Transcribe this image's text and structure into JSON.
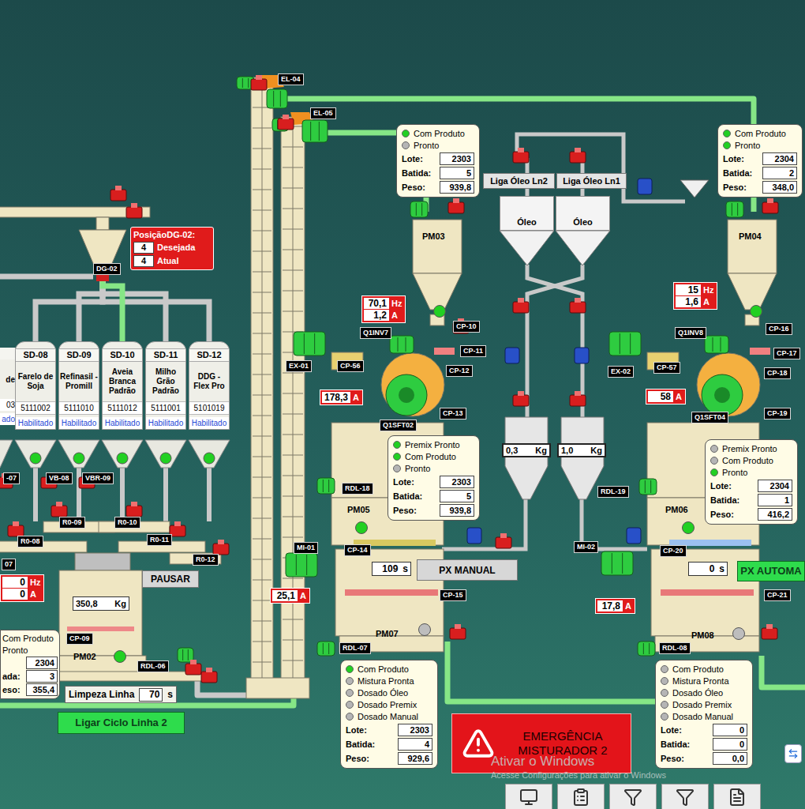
{
  "bins": [
    {
      "tag": "SD-08",
      "product": "Farelo de Soja",
      "code": "5111002",
      "status": "Habilitado",
      "selected": false,
      "ready": true
    },
    {
      "tag": "SD-09",
      "product": "Refinasil - Promill",
      "code": "5111010",
      "status": "Habilitado",
      "selected": false,
      "ready": true
    },
    {
      "tag": "SD-10",
      "product": "Aveia Branca Padrão",
      "code": "5111012",
      "status": "Habilitado",
      "selected": true,
      "ready": true
    },
    {
      "tag": "SD-11",
      "product": "Milho Grão Padrão",
      "code": "5111001",
      "status": "Habilitado",
      "selected": false,
      "ready": true
    },
    {
      "tag": "SD-12",
      "product": "DDG - Flex Pro",
      "code": "5101019",
      "status": "Habilitado",
      "selected": false,
      "ready": true
    }
  ],
  "cut_bin": {
    "product": "de",
    "code": "03",
    "status": "ado"
  },
  "diverter": {
    "tag": "DG-02",
    "title": "PosiçãoDG-02:",
    "rows": [
      {
        "value": "4",
        "label": "Desejada"
      },
      {
        "value": "4",
        "label": "Atual"
      }
    ]
  },
  "tags": [
    "EL-04",
    "EL-05",
    "CP-10",
    "CP-11",
    "CP-12",
    "CP-13",
    "CP-56",
    "EX-01",
    "Q1INV7",
    "Q1SFT02",
    "RDL-18",
    "CP-14",
    "MI-01",
    "CP-15",
    "RDL-07",
    "CP-16",
    "CP-17",
    "CP-18",
    "CP-19",
    "CP-57",
    "EX-02",
    "Q1INV8",
    "Q1SFT04",
    "RDL-19",
    "CP-20",
    "MI-02",
    "CP-21",
    "RDL-08",
    "CP-09",
    "RDL-06",
    "R0-08",
    "R0-09",
    "R0-10",
    "R0-11",
    "R0-12",
    "-07",
    "VB-08",
    "VBR-09",
    "07"
  ],
  "vessels": [
    {
      "label": "PM02",
      "lamp": true
    },
    {
      "label": "PM03",
      "lamp": true
    },
    {
      "label": "PM04",
      "lamp": true
    },
    {
      "label": "PM05",
      "lamp": true
    },
    {
      "label": "PM06",
      "lamp": true
    },
    {
      "label": "PM07",
      "lamp": false
    },
    {
      "label": "PM08",
      "lamp": false
    }
  ],
  "panels": [
    {
      "lamps": [
        {
          "label": "Com Produto",
          "on": true
        },
        {
          "label": "Pronto",
          "on": false
        }
      ],
      "fields": [
        {
          "label": "Lote:",
          "value": "2303"
        },
        {
          "label": "Batida:",
          "value": "5"
        },
        {
          "label": "Peso:",
          "value": "939,8"
        }
      ]
    },
    {
      "lamps": [
        {
          "label": "Com Produto",
          "on": true
        },
        {
          "label": "Pronto",
          "on": true
        }
      ],
      "fields": [
        {
          "label": "Lote:",
          "value": "2304"
        },
        {
          "label": "Batida:",
          "value": "2"
        },
        {
          "label": "Peso:",
          "value": "348,0"
        }
      ]
    },
    {
      "lamps": [
        {
          "label": "Premix Pronto",
          "on": true
        },
        {
          "label": "Com Produto",
          "on": true
        },
        {
          "label": "Pronto",
          "on": false
        }
      ],
      "fields": [
        {
          "label": "Lote:",
          "value": "2303"
        },
        {
          "label": "Batida:",
          "value": "5"
        },
        {
          "label": "Peso:",
          "value": "939,8"
        }
      ]
    },
    {
      "lamps": [
        {
          "label": "Premix Pronto",
          "on": false
        },
        {
          "label": "Com Produto",
          "on": false
        },
        {
          "label": "Pronto",
          "on": true
        }
      ],
      "fields": [
        {
          "label": "Lote:",
          "value": "2304"
        },
        {
          "label": "Batida:",
          "value": "1"
        },
        {
          "label": "Peso:",
          "value": "416,2"
        }
      ]
    },
    {
      "lamps": [
        {
          "label": "Com Produto",
          "on": true
        },
        {
          "label": "Mistura Pronta",
          "on": false
        },
        {
          "label": "Dosado Óleo",
          "on": false
        },
        {
          "label": "Dosado Premix",
          "on": false
        },
        {
          "label": "Dosado Manual",
          "on": false
        }
      ],
      "fields": [
        {
          "label": "Lote:",
          "value": "2303"
        },
        {
          "label": "Batida:",
          "value": "4"
        },
        {
          "label": "Peso:",
          "value": "929,6"
        }
      ]
    },
    {
      "lamps": [
        {
          "label": "Com Produto",
          "on": false
        },
        {
          "label": "Mistura Pronta",
          "on": false
        },
        {
          "label": "Dosado Óleo",
          "on": false
        },
        {
          "label": "Dosado Premix",
          "on": false
        },
        {
          "label": "Dosado Manual",
          "on": false
        }
      ],
      "fields": [
        {
          "label": "Lote:",
          "value": "0"
        },
        {
          "label": "Batida:",
          "value": "0"
        },
        {
          "label": "Peso:",
          "value": "0,0"
        }
      ]
    }
  ],
  "cut_panel": {
    "lines": [
      "Com Produto",
      "Pronto"
    ],
    "fields": [
      {
        "label": "",
        "value": "2304"
      },
      {
        "label": "ada:",
        "value": "3"
      },
      {
        "label": "eso:",
        "value": "355,4"
      }
    ]
  },
  "readouts": [
    {
      "rows": [
        {
          "value": "70,1",
          "unit": "Hz"
        },
        {
          "value": "1,2",
          "unit": "A"
        }
      ]
    },
    {
      "rows": [
        {
          "value": "15",
          "unit": "Hz"
        },
        {
          "value": "1,6",
          "unit": "A"
        }
      ]
    },
    {
      "rows": [
        {
          "value": "0",
          "unit": "Hz"
        },
        {
          "value": "0",
          "unit": "A"
        }
      ]
    },
    {
      "rows": [
        {
          "value": "178,3",
          "unit": "A"
        }
      ]
    },
    {
      "rows": [
        {
          "value": "58",
          "unit": "A"
        }
      ]
    },
    {
      "rows": [
        {
          "value": "25,1",
          "unit": "A"
        }
      ]
    },
    {
      "rows": [
        {
          "value": "17,8",
          "unit": "A"
        }
      ]
    }
  ],
  "scale": {
    "value": "350,8",
    "unit": "Kg"
  },
  "oil": {
    "buttons": [
      "Liga Óleo Ln2",
      "Liga Óleo Ln1"
    ],
    "tanks": [
      "Óleo",
      "Óleo"
    ],
    "scales": [
      {
        "value": "0,3",
        "unit": "Kg"
      },
      {
        "value": "1,0",
        "unit": "Kg"
      }
    ]
  },
  "timers": [
    {
      "value": "109",
      "unit": "s"
    },
    {
      "value": "0",
      "unit": "s"
    }
  ],
  "cleaning": {
    "label": "Limpeza Linha",
    "value": "70",
    "unit": "s"
  },
  "buttons": [
    {
      "label": "PAUSAR",
      "kind": "grey"
    },
    {
      "label": "PX MANUAL",
      "kind": "grey"
    },
    {
      "label": "PX AUTOMA",
      "kind": "green"
    },
    {
      "label": "Ligar Ciclo Linha 2",
      "kind": "green"
    }
  ],
  "emergency": {
    "lines": [
      "EMERGÊNCIA",
      "MISTURADOR 2"
    ]
  },
  "watermark": {
    "title": "Ativar o Windows",
    "subtitle": "Acesse Configurações para ativar o Windows"
  }
}
